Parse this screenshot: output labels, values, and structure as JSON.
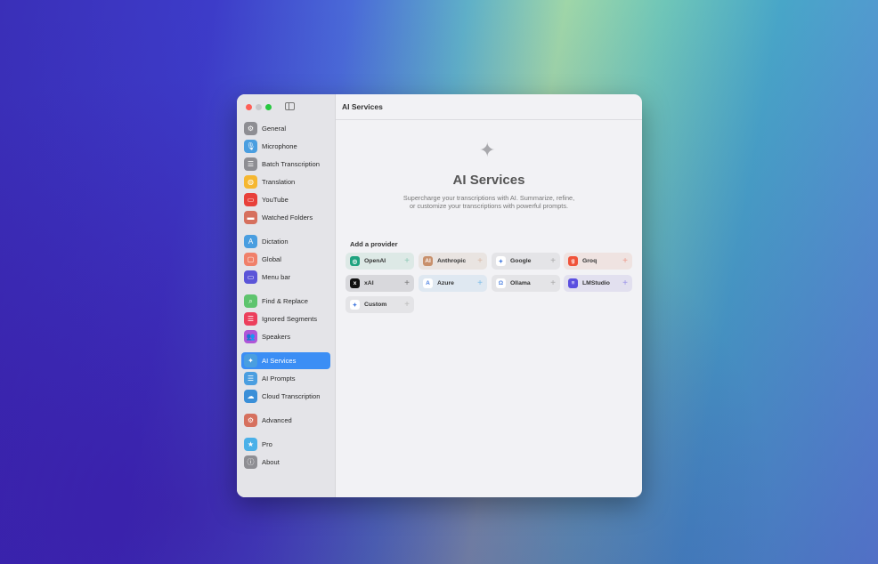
{
  "window": {
    "title": "AI Services"
  },
  "sidebar": {
    "items": [
      {
        "label": "General",
        "icon": "gear-icon",
        "color": "#8e8e93",
        "glyph": "⚙"
      },
      {
        "label": "Microphone",
        "icon": "microphone-icon",
        "color": "#4a9ee0",
        "glyph": "🎙"
      },
      {
        "label": "Batch Transcription",
        "icon": "list-icon",
        "color": "#8e8e93",
        "glyph": "☰"
      },
      {
        "label": "Translation",
        "icon": "globe-icon",
        "color": "#f5b731",
        "glyph": "◍"
      },
      {
        "label": "YouTube",
        "icon": "tv-icon",
        "color": "#e8403a",
        "glyph": "▭"
      },
      {
        "label": "Watched Folders",
        "icon": "folder-icon",
        "color": "#d6705e",
        "glyph": "▬"
      },
      {
        "label": "Dictation",
        "icon": "text-cursor-icon",
        "color": "#4a9ee0",
        "glyph": "A"
      },
      {
        "label": "Global",
        "icon": "window-icon",
        "color": "#f0806a",
        "glyph": "▢"
      },
      {
        "label": "Menu bar",
        "icon": "menubar-icon",
        "color": "#5b55d8",
        "glyph": "▭"
      },
      {
        "label": "Find & Replace",
        "icon": "find-icon",
        "color": "#5ec46e",
        "glyph": "⌕"
      },
      {
        "label": "Ignored Segments",
        "icon": "ignored-icon",
        "color": "#ec3f5c",
        "glyph": "☰"
      },
      {
        "label": "Speakers",
        "icon": "people-icon",
        "color": "#b056d8",
        "glyph": "👥"
      },
      {
        "label": "AI Services",
        "icon": "sparkle-icon",
        "color": "#4a9ee0",
        "glyph": "✦"
      },
      {
        "label": "AI Prompts",
        "icon": "list-icon",
        "color": "#4a9ee0",
        "glyph": "☰"
      },
      {
        "label": "Cloud Transcription",
        "icon": "cloud-icon",
        "color": "#3a8fd8",
        "glyph": "☁"
      },
      {
        "label": "Advanced",
        "icon": "gears-icon",
        "color": "#d6705e",
        "glyph": "⚙"
      },
      {
        "label": "Pro",
        "icon": "star-icon",
        "color": "#4ab0e8",
        "glyph": "★"
      },
      {
        "label": "About",
        "icon": "info-icon",
        "color": "#8e8e93",
        "glyph": "ⓘ"
      }
    ],
    "active": "AI Services"
  },
  "main": {
    "heading": "AI Services",
    "subtitle_line1": "Supercharge your transcriptions with AI. Summarize, refine,",
    "subtitle_line2": "or customize your transcriptions with powerful prompts.",
    "add_provider_label": "Add a provider",
    "providers": [
      {
        "name": "OpenAI",
        "bg": "#dde9e6",
        "logo": "#1ea37f",
        "glyph": "◎",
        "plus": "#8fc9b7"
      },
      {
        "name": "Anthropic",
        "bg": "#e9e4e1",
        "logo": "#c8906c",
        "glyph": "AI",
        "plus": "#d8b9a6"
      },
      {
        "name": "Google",
        "bg": "#e4e4e7",
        "logo": "#ffffff",
        "glyph": "✦",
        "plus": "#aaa"
      },
      {
        "name": "Groq",
        "bg": "#efe3e1",
        "logo": "#f0533a",
        "glyph": "g",
        "plus": "#ee9a8c"
      },
      {
        "name": "xAI",
        "bg": "#d8d8dc",
        "logo": "#111111",
        "glyph": "x",
        "plus": "#777"
      },
      {
        "name": "Azure",
        "bg": "#dfe8f1",
        "logo": "#ffffff",
        "glyph": "A",
        "plus": "#7ebde8"
      },
      {
        "name": "Ollama",
        "bg": "#e4e4e7",
        "logo": "#ffffff",
        "glyph": "Ω",
        "plus": "#aaa"
      },
      {
        "name": "LMStudio",
        "bg": "#e2e0ef",
        "logo": "#5b4fe0",
        "glyph": "≡",
        "plus": "#9b93e8"
      },
      {
        "name": "Custom",
        "bg": "#e4e4e7",
        "logo": "#ffffff",
        "glyph": "✦",
        "plus": "#bbb"
      }
    ]
  }
}
